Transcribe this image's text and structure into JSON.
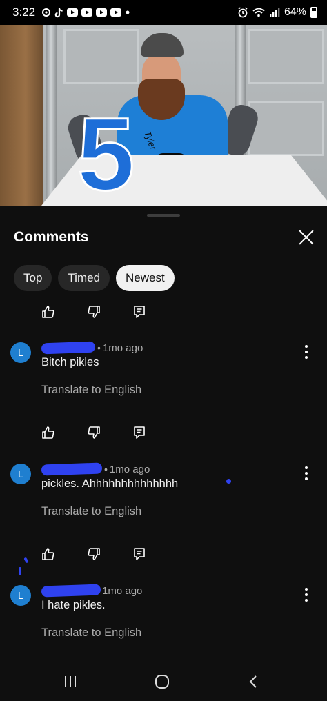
{
  "status_bar": {
    "time": "3:22",
    "battery": "64%",
    "icons": [
      "threads-icon",
      "tiktok-icon",
      "youtube-icon",
      "youtube-icon",
      "youtube-icon",
      "youtube-icon",
      "dot-icon",
      "alarm-icon",
      "wifi-icon",
      "signal-icon",
      "battery-icon"
    ]
  },
  "video": {
    "overlay_number": "5",
    "shirt_text": "Tyler"
  },
  "comments": {
    "title": "Comments",
    "filters": [
      {
        "label": "Top",
        "active": false
      },
      {
        "label": "Timed",
        "active": false
      },
      {
        "label": "Newest",
        "active": true
      }
    ],
    "items": [
      {
        "avatar": "L",
        "author_redacted": true,
        "timestamp": "1mo ago",
        "text": "Bitch pikles",
        "translate": "Translate to English"
      },
      {
        "avatar": "L",
        "author_redacted": true,
        "timestamp": "1mo ago",
        "text": "pickles. Ahhhhhhhhhhhhhh",
        "translate": "Translate to English"
      },
      {
        "avatar": "L",
        "author_redacted": true,
        "timestamp": "1mo ago",
        "text": "I hate pikles.",
        "translate": "Translate to English"
      }
    ]
  },
  "colors": {
    "background": "#0f0f0f",
    "chip": "#272727",
    "chip_active": "#f1f1f1",
    "avatar": "#1f7fd0",
    "redaction": "#2f42f0",
    "secondary_text": "#aaaaaa"
  }
}
